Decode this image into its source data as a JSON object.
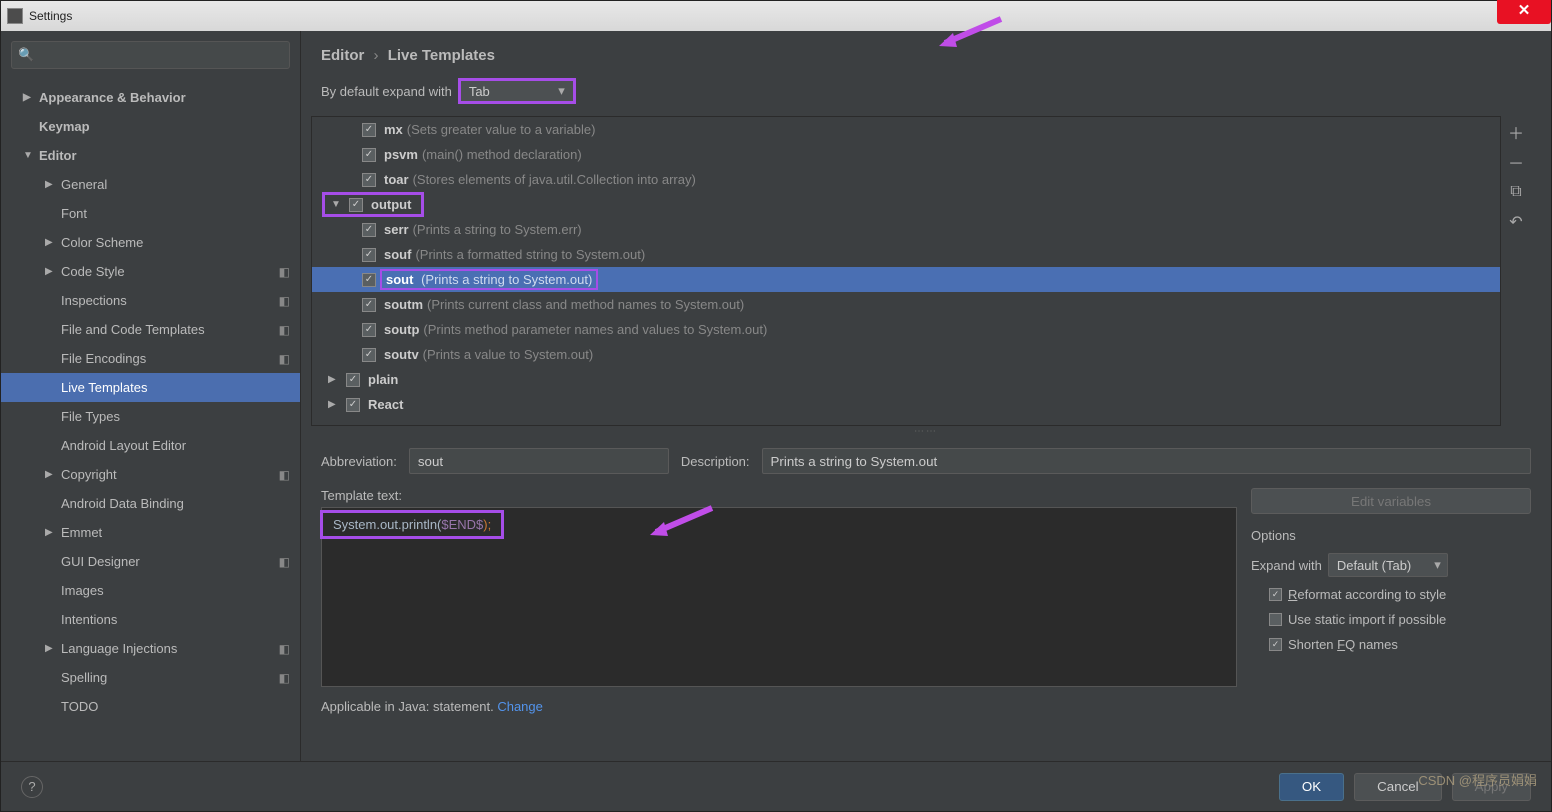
{
  "window": {
    "title": "Settings"
  },
  "search": {
    "placeholder": "Q▾"
  },
  "sidebar": {
    "items": [
      {
        "label": "Appearance & Behavior",
        "level": 0,
        "arrow": "▶",
        "bold": true
      },
      {
        "label": "Keymap",
        "level": 0,
        "arrow": "",
        "bold": true
      },
      {
        "label": "Editor",
        "level": 0,
        "arrow": "▼",
        "bold": true
      },
      {
        "label": "General",
        "level": 1,
        "arrow": "▶"
      },
      {
        "label": "Font",
        "level": 1,
        "arrow": ""
      },
      {
        "label": "Color Scheme",
        "level": 1,
        "arrow": "▶"
      },
      {
        "label": "Code Style",
        "level": 1,
        "arrow": "▶",
        "cfg": true
      },
      {
        "label": "Inspections",
        "level": 1,
        "arrow": "",
        "cfg": true
      },
      {
        "label": "File and Code Templates",
        "level": 1,
        "arrow": "",
        "cfg": true
      },
      {
        "label": "File Encodings",
        "level": 1,
        "arrow": "",
        "cfg": true
      },
      {
        "label": "Live Templates",
        "level": 1,
        "arrow": "",
        "selected": true
      },
      {
        "label": "File Types",
        "level": 1,
        "arrow": ""
      },
      {
        "label": "Android Layout Editor",
        "level": 1,
        "arrow": ""
      },
      {
        "label": "Copyright",
        "level": 1,
        "arrow": "▶",
        "cfg": true
      },
      {
        "label": "Android Data Binding",
        "level": 1,
        "arrow": ""
      },
      {
        "label": "Emmet",
        "level": 1,
        "arrow": "▶"
      },
      {
        "label": "GUI Designer",
        "level": 1,
        "arrow": "",
        "cfg": true
      },
      {
        "label": "Images",
        "level": 1,
        "arrow": ""
      },
      {
        "label": "Intentions",
        "level": 1,
        "arrow": ""
      },
      {
        "label": "Language Injections",
        "level": 1,
        "arrow": "▶",
        "cfg": true
      },
      {
        "label": "Spelling",
        "level": 1,
        "arrow": "",
        "cfg": true
      },
      {
        "label": "TODO",
        "level": 1,
        "arrow": ""
      }
    ]
  },
  "breadcrumb": {
    "p1": "Editor",
    "p2": "Live Templates"
  },
  "expand": {
    "label": "By default expand with",
    "value": "Tab"
  },
  "templates": [
    {
      "indent": 1,
      "name": "mx",
      "desc": "(Sets greater value to a variable)"
    },
    {
      "indent": 1,
      "name": "psvm",
      "desc": "(main() method declaration)"
    },
    {
      "indent": 1,
      "name": "toar",
      "desc": "(Stores elements of java.util.Collection into array)"
    },
    {
      "indent": 0,
      "name": "output",
      "desc": "",
      "expander": "▼",
      "group_hl": true
    },
    {
      "indent": 1,
      "name": "serr",
      "desc": "(Prints a string to System.err)"
    },
    {
      "indent": 1,
      "name": "souf",
      "desc": "(Prints a formatted string to System.out)"
    },
    {
      "indent": 1,
      "name": "sout",
      "desc": "(Prints a string to System.out)",
      "selected": true,
      "sel_hl": true
    },
    {
      "indent": 1,
      "name": "soutm",
      "desc": "(Prints current class and method names to System.out)"
    },
    {
      "indent": 1,
      "name": "soutp",
      "desc": "(Prints method parameter names and values to System.out)"
    },
    {
      "indent": 1,
      "name": "soutv",
      "desc": "(Prints a value to System.out)"
    },
    {
      "indent": 0,
      "name": "plain",
      "desc": "",
      "expander": "▶"
    },
    {
      "indent": 0,
      "name": "React",
      "desc": "",
      "expander": "▶"
    }
  ],
  "fields": {
    "abbrev_label": "Abbreviation:",
    "abbrev_value": "sout",
    "desc_label": "Description:",
    "desc_value": "Prints a string to System.out"
  },
  "template_text": {
    "label": "Template text:",
    "code_parts": {
      "a": "System.out.println(",
      "b": "$END$",
      "c": ");"
    },
    "edit_vars": "Edit variables"
  },
  "options": {
    "title": "Options",
    "expand_label": "Expand with",
    "expand_value": "Default (Tab)",
    "reformat": "Reformat according to style",
    "static_import": "Use static import if possible",
    "shorten": "Shorten FQ names"
  },
  "applicable": {
    "text": "Applicable in Java: statement. ",
    "link": "Change"
  },
  "footer": {
    "ok": "OK",
    "cancel": "Cancel",
    "apply": "Apply"
  },
  "watermark": "CSDN @程序员娟娟"
}
